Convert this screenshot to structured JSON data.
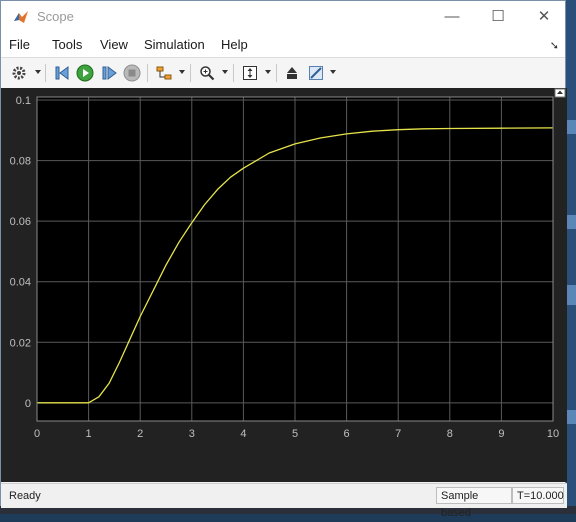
{
  "window": {
    "title": "Scope"
  },
  "controls": {
    "minimize": "—",
    "maximize": "☐",
    "close": "✕"
  },
  "menu": [
    "File",
    "Tools",
    "View",
    "Simulation",
    "Help"
  ],
  "toolbar_icons": [
    "gear-icon",
    "step-back-icon",
    "run-icon",
    "step-forward-icon",
    "stop-icon",
    "signal-select-icon",
    "zoom-icon",
    "fit-axes-icon",
    "restore-icon",
    "highlight-icon"
  ],
  "colors": {
    "accent_line": "#e6e34a",
    "axes_bg": "#000000",
    "figure_bg": "#222222",
    "grid": "#5a5a5a"
  },
  "status": {
    "left": "Ready",
    "mode": "Sample based",
    "time": "T=10.000"
  },
  "chart_data": {
    "type": "line",
    "title": "",
    "xlabel": "",
    "ylabel": "",
    "xlim": [
      0,
      10
    ],
    "ylim": [
      -0.006,
      0.101
    ],
    "xticks": [
      "0",
      "1",
      "2",
      "3",
      "4",
      "5",
      "6",
      "7",
      "8",
      "9",
      "10"
    ],
    "yticks": [
      "0",
      "0.02",
      "0.04",
      "0.06",
      "0.08",
      "0.1"
    ],
    "ytick_values": [
      0,
      0.02,
      0.04,
      0.06,
      0.08,
      0.1
    ],
    "grid": true,
    "series": [
      {
        "color": "#e6e34a",
        "x": [
          0,
          1,
          1.2,
          1.4,
          1.6,
          1.8,
          2,
          2.25,
          2.5,
          2.75,
          3,
          3.25,
          3.5,
          3.75,
          4,
          4.5,
          5,
          5.5,
          6,
          6.5,
          7,
          7.5,
          8,
          9,
          10
        ],
        "y": [
          0,
          0,
          0.002,
          0.0065,
          0.0135,
          0.021,
          0.0285,
          0.037,
          0.0455,
          0.053,
          0.0595,
          0.0655,
          0.0705,
          0.0745,
          0.0775,
          0.0825,
          0.0855,
          0.0875,
          0.0888,
          0.0897,
          0.0902,
          0.0905,
          0.0906,
          0.0907,
          0.0908
        ]
      }
    ]
  }
}
